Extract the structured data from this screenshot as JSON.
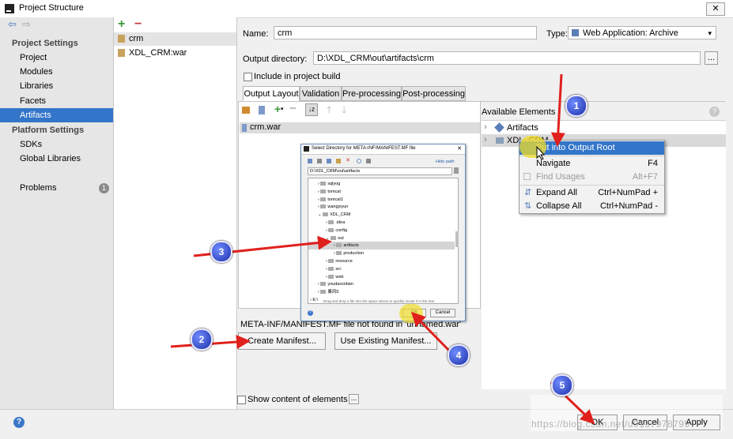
{
  "window": {
    "title": "Project Structure",
    "close_glyph": "✕"
  },
  "nav": {
    "back_glyph": "⇦",
    "forward_glyph": "⇨",
    "project_settings": "Project Settings",
    "items": [
      "Project",
      "Modules",
      "Libraries",
      "Facets",
      "Artifacts"
    ],
    "platform_settings": "Platform Settings",
    "platform_items": [
      "SDKs",
      "Global Libraries"
    ],
    "problems": "Problems",
    "problems_count": "1"
  },
  "artifacts": {
    "add_glyph": "+",
    "remove_glyph": "−",
    "list": [
      "crm",
      "XDL_CRM:war"
    ]
  },
  "form": {
    "name_label": "Name:",
    "name_value": "crm",
    "type_label": "Type:",
    "type_value": "Web Application: Archive",
    "output_label": "Output directory:",
    "output_value": "D:\\XDL_CRM\\out\\artifacts\\crm",
    "browse_label": "...",
    "include_build_label": "Include in project build"
  },
  "tabs": [
    "Output Layout",
    "Validation",
    "Pre-processing",
    "Post-processing"
  ],
  "layout_tree": {
    "root": "crm.war"
  },
  "manifest": {
    "message": "META-INF/MANIFEST.MF file not found in 'unnamed.war'",
    "create_label": "Create Manifest...",
    "use_existing_label": "Use Existing Manifest..."
  },
  "show_content_label": "Show content of elements",
  "show_content_button": "...",
  "available": {
    "header": "Available Elements",
    "help_glyph": "?",
    "items": [
      "Artifacts",
      "XDL_CRM"
    ]
  },
  "context_menu": {
    "items": [
      {
        "label": "Put into Output Root",
        "shortcut": ""
      },
      {
        "label": "Navigate",
        "shortcut": "F4"
      },
      {
        "label": "Find Usages",
        "shortcut": "Alt+F7"
      },
      {
        "label": "Expand All",
        "shortcut": "Ctrl+NumPad +"
      },
      {
        "label": "Collapse All",
        "shortcut": "Ctrl+NumPad -"
      }
    ]
  },
  "dialog": {
    "title": "Select Directory for META-INF/MANIFEST.MF file",
    "hide_path": "Hide path",
    "path": "D:\\XDL_CRM\\out\\artifacts",
    "tree": [
      {
        "label": "sqlyog",
        "depth": 0
      },
      {
        "label": "tomcat",
        "depth": 0
      },
      {
        "label": "tomcat1",
        "depth": 0
      },
      {
        "label": "wangyiyun",
        "depth": 0
      },
      {
        "label": "XDL_CRM",
        "depth": 0
      },
      {
        "label": ".idea",
        "depth": 1
      },
      {
        "label": "config",
        "depth": 1
      },
      {
        "label": "out",
        "depth": 1
      },
      {
        "label": "artifacts",
        "depth": 2
      },
      {
        "label": "production",
        "depth": 2
      },
      {
        "label": "resource",
        "depth": 1
      },
      {
        "label": "src",
        "depth": 1
      },
      {
        "label": "web",
        "depth": 1
      },
      {
        "label": "youdaocidian",
        "depth": 0
      },
      {
        "label": "暴风5",
        "depth": 0
      },
      {
        "label": "E:\\",
        "depth": -1
      }
    ],
    "hint": "Drag and drop a file into the space above to quickly locate it in the tree",
    "ok_label": "OK",
    "cancel_label": "Cancel"
  },
  "footer": {
    "help_glyph": "?",
    "ok_label": "OK",
    "cancel_label": "Cancel",
    "apply_label": "Apply",
    "watermark": "https://blog.csdn.net/u0137978795"
  },
  "callouts": [
    "1",
    "2",
    "3",
    "4",
    "5"
  ],
  "colors": {
    "selection": "#3375c9",
    "arrow": "#e0201c",
    "callout": "#2438c4"
  }
}
